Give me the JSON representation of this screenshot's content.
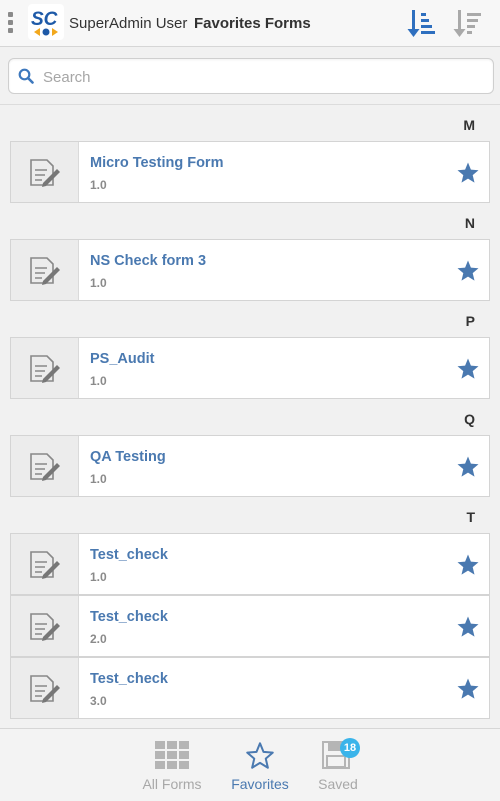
{
  "header": {
    "logo_text": "SC",
    "user_name": "SuperAdmin User",
    "title": "Favorites Forms",
    "sort_asc_icon": "sort-ascending-icon",
    "sort_desc_icon": "sort-descending-icon"
  },
  "search": {
    "placeholder": "Search",
    "value": ""
  },
  "sections": [
    {
      "letter": "M",
      "forms": [
        {
          "name": "Micro Testing Form",
          "version": "1.0"
        }
      ]
    },
    {
      "letter": "N",
      "forms": [
        {
          "name": "NS Check form 3",
          "version": "1.0"
        }
      ]
    },
    {
      "letter": "P",
      "forms": [
        {
          "name": "PS_Audit",
          "version": "1.0"
        }
      ]
    },
    {
      "letter": "Q",
      "forms": [
        {
          "name": "QA Testing",
          "version": "1.0"
        }
      ]
    },
    {
      "letter": "T",
      "forms": [
        {
          "name": "Test_check",
          "version": "1.0"
        },
        {
          "name": "Test_check",
          "version": "2.0"
        },
        {
          "name": "Test_check",
          "version": "3.0"
        }
      ]
    }
  ],
  "bottom_nav": {
    "all_forms": "All Forms",
    "favorites": "Favorites",
    "saved": "Saved",
    "saved_badge": "18",
    "active": "favorites"
  },
  "colors": {
    "accent": "#4a79b0",
    "star": "#4a79b0",
    "badge": "#3ab4ea",
    "inactive": "#a8a8a8",
    "version_text": "#8a8a8a"
  }
}
